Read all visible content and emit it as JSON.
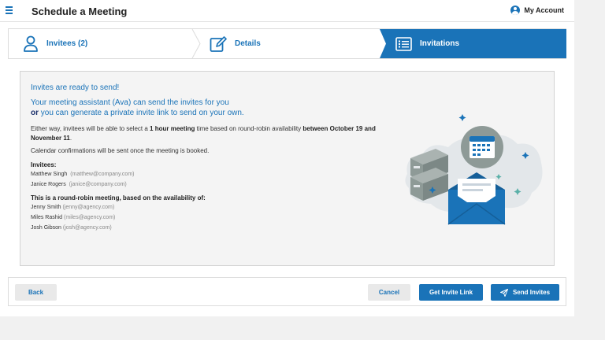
{
  "app": {
    "title": "Schedule a Meeting",
    "account_label": "My Account"
  },
  "stepper": {
    "steps": [
      {
        "label": "Invitees (2)",
        "icon": "person-icon"
      },
      {
        "label": "Details",
        "icon": "edit-icon"
      },
      {
        "label": "Invitations",
        "icon": "list-icon"
      }
    ]
  },
  "content": {
    "ready": "Invites are ready to send!",
    "line1": "Your meeting assistant (Ava) can send the invites for you",
    "line2_or": "or",
    "line2_rest": " you can generate a private invite link to send on your own.",
    "para_1": "Either way, invitees will be able to select a ",
    "para_bold_1": "1 hour meeting",
    "para_2": " time based on round-robin availability ",
    "para_bold_2": "between October 19 and November 11",
    "para_3": ".",
    "confirm": "Calendar confirmations will be sent once the meeting is booked.",
    "invitees_heading": "Invitees:",
    "invitees": [
      {
        "name": "Matthew Singh",
        "email": "(matthew@company.com)"
      },
      {
        "name": "Janice Rogers",
        "email": "(janice@company.com)"
      }
    ],
    "roundrobin_heading": "This is a round-robin meeting, based on the availability of:",
    "roundrobin": [
      {
        "name": "Jenny Smith",
        "email": "(jenny@agency.com)"
      },
      {
        "name": "Miles Rashid",
        "email": "(miles@agency.com)"
      },
      {
        "name": "Josh Gibson",
        "email": "(josh@agency.com)"
      }
    ]
  },
  "footer": {
    "back": "Back",
    "cancel": "Cancel",
    "get_link": "Get Invite Link",
    "send": "Send Invites"
  },
  "colors": {
    "primary": "#1a73b8",
    "illustration_gray": "#8e9a97",
    "illustration_blob": "#e3e7ea"
  }
}
